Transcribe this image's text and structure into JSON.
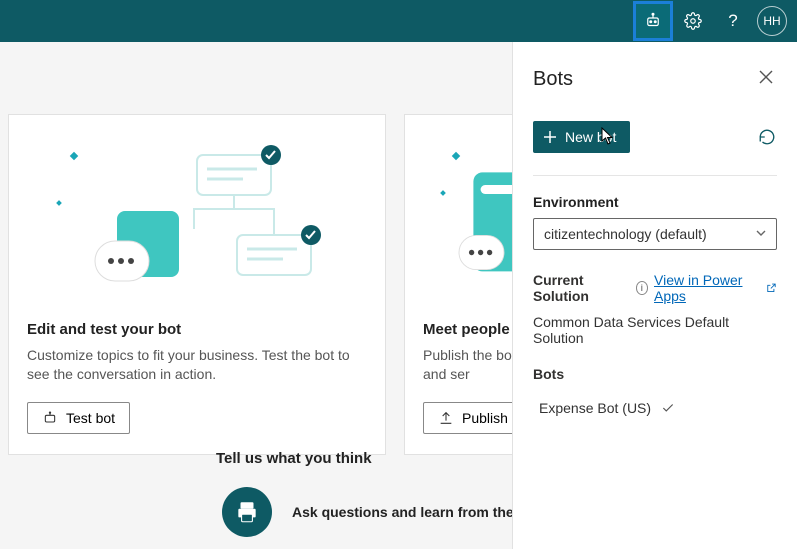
{
  "header": {
    "avatar_initials": "HH"
  },
  "cards": [
    {
      "title": "Edit and test your bot",
      "desc": "Customize topics to fit your business. Test the bot to see the conversation in action.",
      "button": "Test bot"
    },
    {
      "title": "Meet people whe",
      "desc": "Publish the bot a products and ser",
      "button": "Publish b"
    }
  ],
  "feedback": {
    "heading": "Tell us what you think",
    "line1": "Ask questions and learn from the con"
  },
  "panel": {
    "title": "Bots",
    "new_bot": "New bot",
    "env_label": "Environment",
    "env_value": "citizentechnology (default)",
    "solution_label": "Current Solution",
    "view_link": "View in Power Apps",
    "solution_name": "Common Data Services Default Solution",
    "bots_label": "Bots",
    "bot_items": [
      "Expense Bot (US)"
    ]
  }
}
